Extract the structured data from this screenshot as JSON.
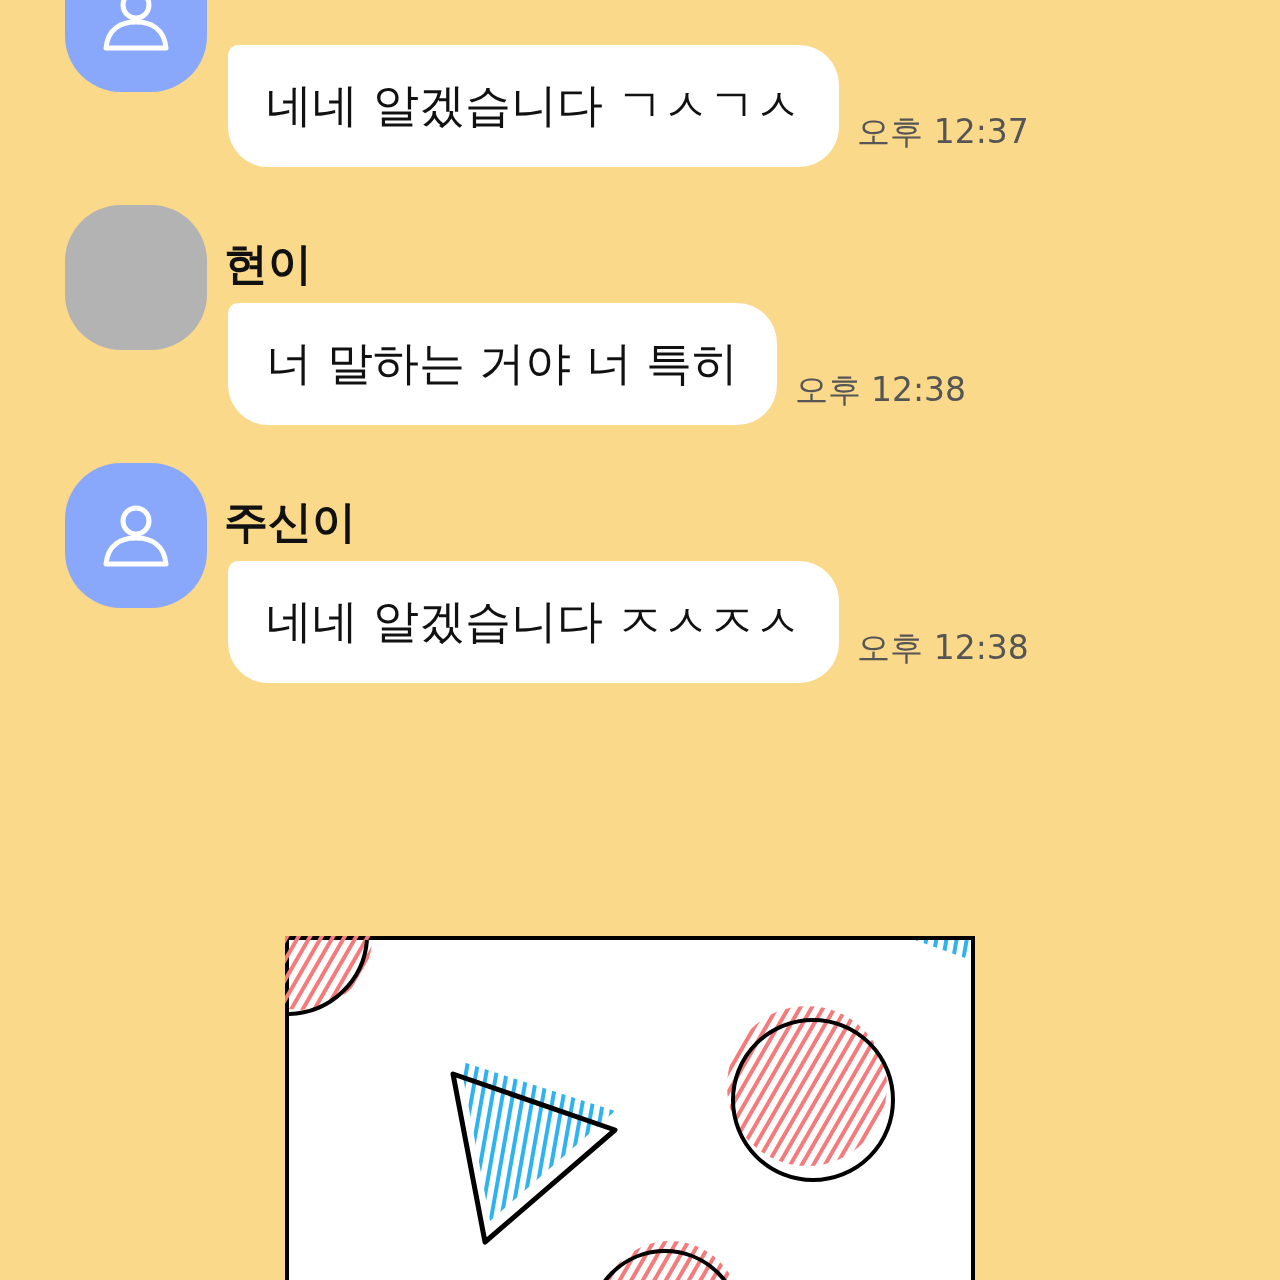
{
  "messages": [
    {
      "kind": "person",
      "color": "#8aa8fb",
      "text": "네네 알겠습니다 ㄱㅅㄱㅅ",
      "time": "오후 12:37"
    },
    {
      "kind": "blank",
      "color": "#b3b3b3",
      "sender": "현이",
      "text": "너 말하는 거야 너 특히",
      "time": "오후 12:38"
    },
    {
      "kind": "person",
      "color": "#8aa8fb",
      "sender": "주신이",
      "text": "네네 알겠습니다 ㅈㅅㅈㅅ",
      "time": "오후 12:38"
    }
  ]
}
